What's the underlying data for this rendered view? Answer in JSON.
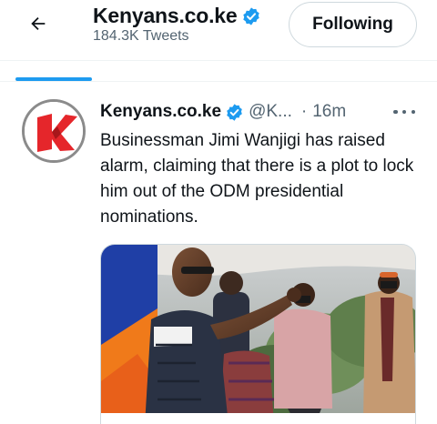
{
  "header": {
    "title": "Kenyans.co.ke",
    "tweet_count": "184.3K Tweets",
    "follow_label": "Following"
  },
  "tweet": {
    "author_name": "Kenyans.co.ke",
    "handle": "@K...",
    "separator": "·",
    "time": "16m",
    "text": "Businessman Jimi Wanjigi has raised alarm, claiming that there is a plot to lock him out of the ODM presidential nominations."
  },
  "colors": {
    "accent": "#1d9bf0",
    "verified": "#1d9bf0",
    "secondary_text": "#536471",
    "logo_red": "#e5262b"
  },
  "icons": {
    "back": "arrow-left-icon",
    "verified": "verified-badge-icon",
    "more": "more-horizontal-icon"
  }
}
